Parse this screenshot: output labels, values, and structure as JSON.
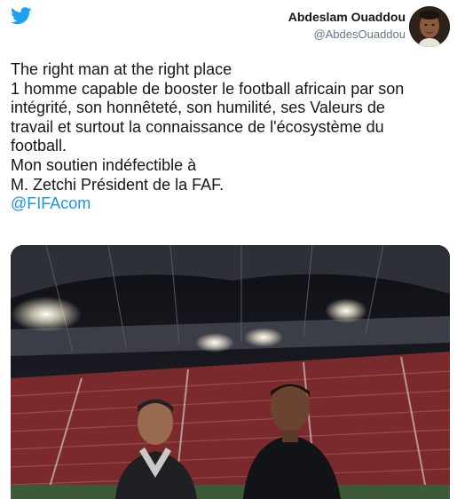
{
  "author": {
    "name": "Abdeslam Ouaddou",
    "handle": "@AbdesOuaddou"
  },
  "tweet": {
    "lines": [
      "The right man at the right place",
      "1 homme capable de booster le football africain par son",
      "intégrité, son honnêteté, son humilité, ses Valeurs de",
      "travail et surtout la connaissance de  l'écosystème du",
      "football.",
      "Mon soutien indéfectible à",
      "M. Zetchi Président de la FAF."
    ],
    "mention": "@FIFAcom"
  },
  "colors": {
    "twitter_blue": "#1da1f2",
    "link_blue": "#1b95e0",
    "text": "#14171a",
    "handle_gray": "#657786"
  },
  "icons": {
    "brand": "twitter-bird-icon"
  }
}
